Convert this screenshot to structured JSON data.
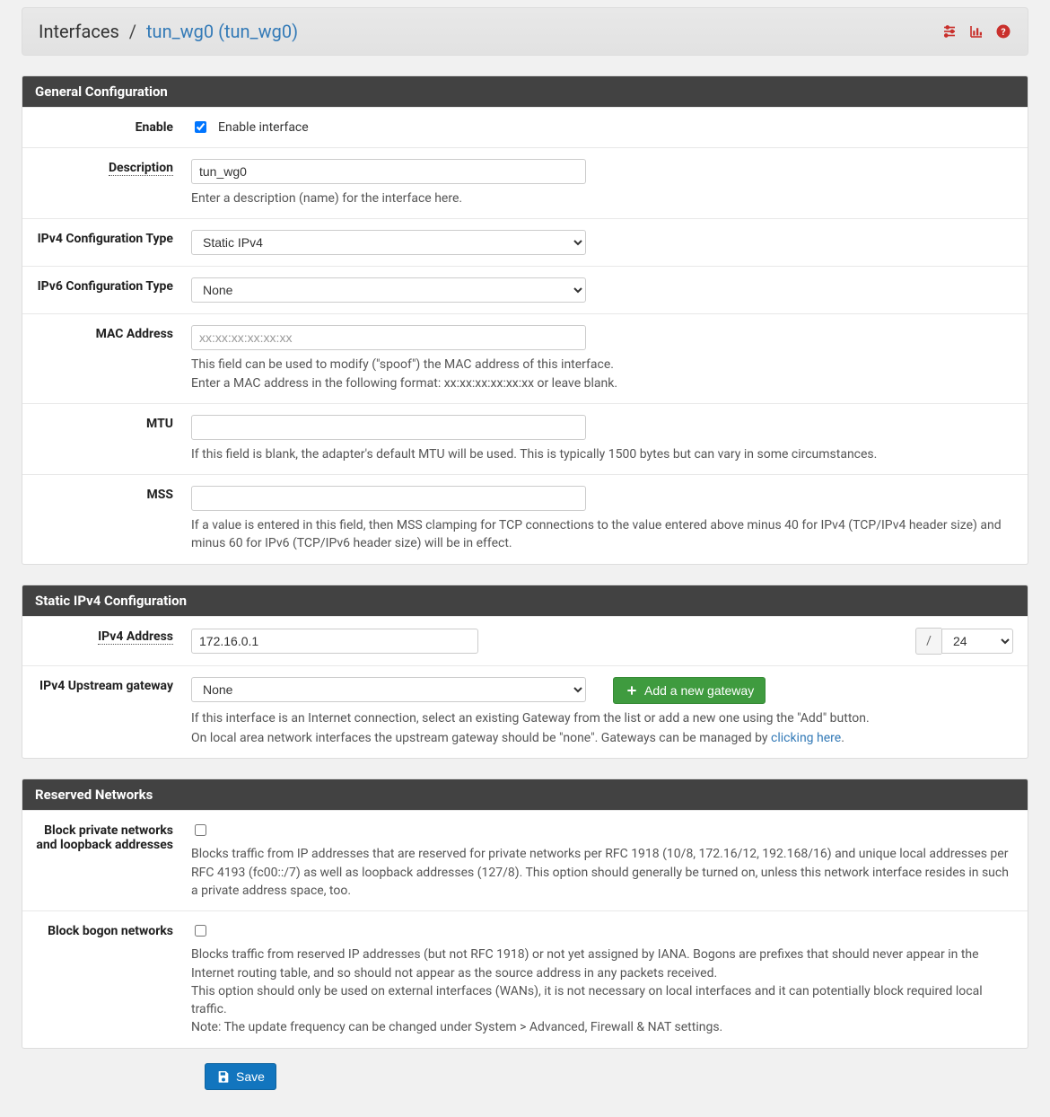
{
  "breadcrumb": {
    "root": "Interfaces",
    "current": "tun_wg0 (tun_wg0)"
  },
  "sections": {
    "general": {
      "title": "General Configuration"
    },
    "static_v4": {
      "title": "Static IPv4 Configuration"
    },
    "reserved": {
      "title": "Reserved Networks"
    }
  },
  "fields": {
    "enable": {
      "label": "Enable",
      "checkbox_label": "Enable interface",
      "checked": true
    },
    "description": {
      "label": "Description",
      "value": "tun_wg0",
      "help": "Enter a description (name) for the interface here."
    },
    "ipv4type": {
      "label": "IPv4 Configuration Type",
      "value": "Static IPv4"
    },
    "ipv6type": {
      "label": "IPv6 Configuration Type",
      "value": "None"
    },
    "mac": {
      "label": "MAC Address",
      "placeholder": "xx:xx:xx:xx:xx:xx",
      "help1": "This field can be used to modify (\"spoof\") the MAC address of this interface.",
      "help2": "Enter a MAC address in the following format: xx:xx:xx:xx:xx:xx or leave blank."
    },
    "mtu": {
      "label": "MTU",
      "help": "If this field is blank, the adapter's default MTU will be used. This is typically 1500 bytes but can vary in some circumstances."
    },
    "mss": {
      "label": "MSS",
      "help": "If a value is entered in this field, then MSS clamping for TCP connections to the value entered above minus 40 for IPv4 (TCP/IPv4 header size) and minus 60 for IPv6 (TCP/IPv6 header size) will be in effect."
    },
    "ipv4addr": {
      "label": "IPv4 Address",
      "value": "172.16.0.1",
      "cidr": "24"
    },
    "gateway": {
      "label": "IPv4 Upstream gateway",
      "value": "None",
      "add_label": "Add a new gateway",
      "help1": "If this interface is an Internet connection, select an existing Gateway from the list or add a new one using the \"Add\" button.",
      "help2_prefix": "On local area network interfaces the upstream gateway should be \"none\". Gateways can be managed by ",
      "help2_link": "clicking here",
      "help2_suffix": "."
    },
    "block_private": {
      "label": "Block private networks and loopback addresses",
      "help": "Blocks traffic from IP addresses that are reserved for private networks per RFC 1918 (10/8, 172.16/12, 192.168/16) and unique local addresses per RFC 4193 (fc00::/7) as well as loopback addresses (127/8). This option should generally be turned on, unless this network interface resides in such a private address space, too."
    },
    "block_bogon": {
      "label": "Block bogon networks",
      "help1": "Blocks traffic from reserved IP addresses (but not RFC 1918) or not yet assigned by IANA. Bogons are prefixes that should never appear in the Internet routing table, and so should not appear as the source address in any packets received.",
      "help2": "This option should only be used on external interfaces (WANs), it is not necessary on local interfaces and it can potentially block required local traffic.",
      "help3": "Note: The update frequency can be changed under System > Advanced, Firewall & NAT settings."
    }
  },
  "buttons": {
    "save": "Save"
  }
}
